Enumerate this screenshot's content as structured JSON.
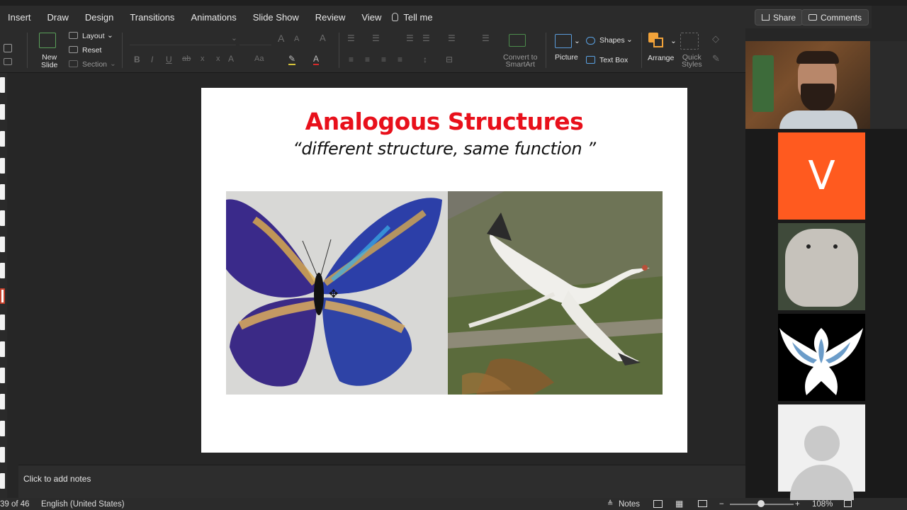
{
  "menu": {
    "tabs": [
      "Insert",
      "Draw",
      "Design",
      "Transitions",
      "Animations",
      "Slide Show",
      "Review",
      "View"
    ],
    "tell_me": "Tell me",
    "share": "Share",
    "comments": "Comments"
  },
  "ribbon": {
    "new_slide": "New\nSlide",
    "layout": "Layout",
    "reset": "Reset",
    "section": "Section",
    "convert_smartart": "Convert to\nSmartArt",
    "picture": "Picture",
    "shapes": "Shapes",
    "text_box": "Text Box",
    "arrange": "Arrange",
    "quick_styles": "Quick\nStyles"
  },
  "slide": {
    "title": "Analogous Structures",
    "subtitle": "“different structure, same function ”",
    "title_color": "#e8101b"
  },
  "notes": {
    "placeholder": "Click to add notes"
  },
  "status": {
    "slide_counter": "39 of 46",
    "language": "English (United States)",
    "notes_btn": "Notes",
    "zoom": "108%"
  },
  "video": {
    "participant_initial": "V",
    "tile_color": "#ff5a1f"
  }
}
